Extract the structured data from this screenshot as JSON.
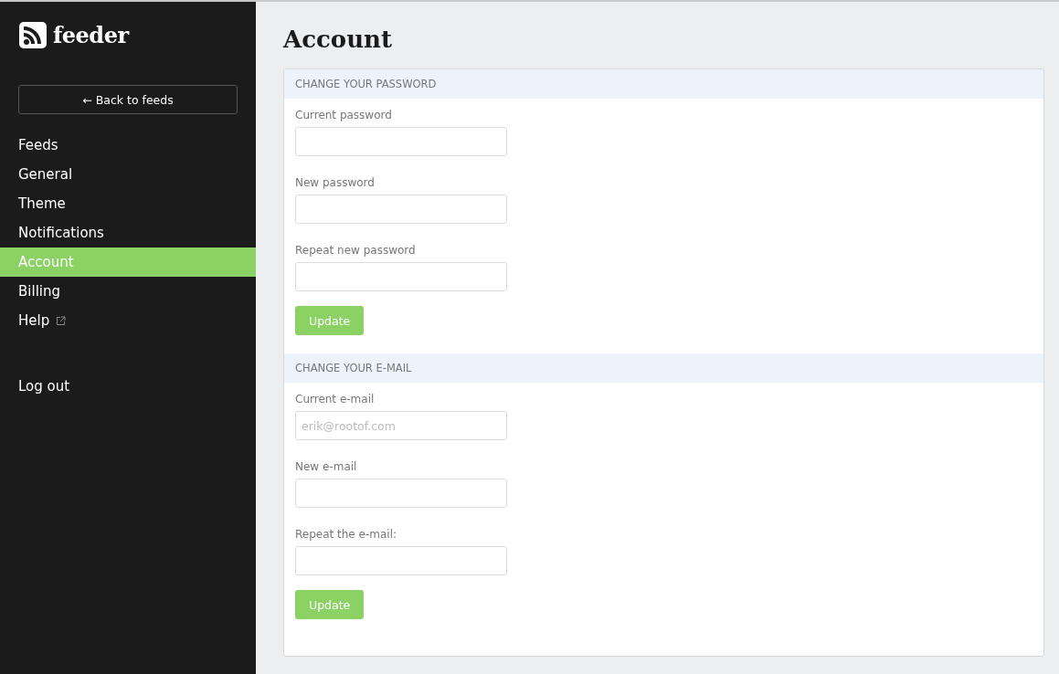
{
  "sidebar": {
    "logo": "feeder",
    "back_button": "← Back to feeds",
    "items": [
      {
        "label": "Feeds",
        "selected": false,
        "external": false
      },
      {
        "label": "General",
        "selected": false,
        "external": false
      },
      {
        "label": "Theme",
        "selected": false,
        "external": false
      },
      {
        "label": "Notifications",
        "selected": false,
        "external": false
      },
      {
        "label": "Account",
        "selected": true,
        "external": false
      },
      {
        "label": "Billing",
        "selected": false,
        "external": false
      },
      {
        "label": "Help",
        "selected": false,
        "external": true
      }
    ],
    "logout": "Log out"
  },
  "page": {
    "title": "Account",
    "sections": [
      {
        "heading": "CHANGE YOUR PASSWORD",
        "fields": [
          {
            "label": "Current password"
          },
          {
            "label": "New password"
          },
          {
            "label": "Repeat new password"
          }
        ],
        "button": "Update"
      },
      {
        "heading": "CHANGE YOUR E-MAIL",
        "fields": [
          {
            "label": "Current e-mail",
            "placeholder": "erik@rootof.com"
          },
          {
            "label": "New e-mail"
          },
          {
            "label": "Repeat the e-mail:"
          }
        ],
        "button": "Update"
      }
    ]
  }
}
